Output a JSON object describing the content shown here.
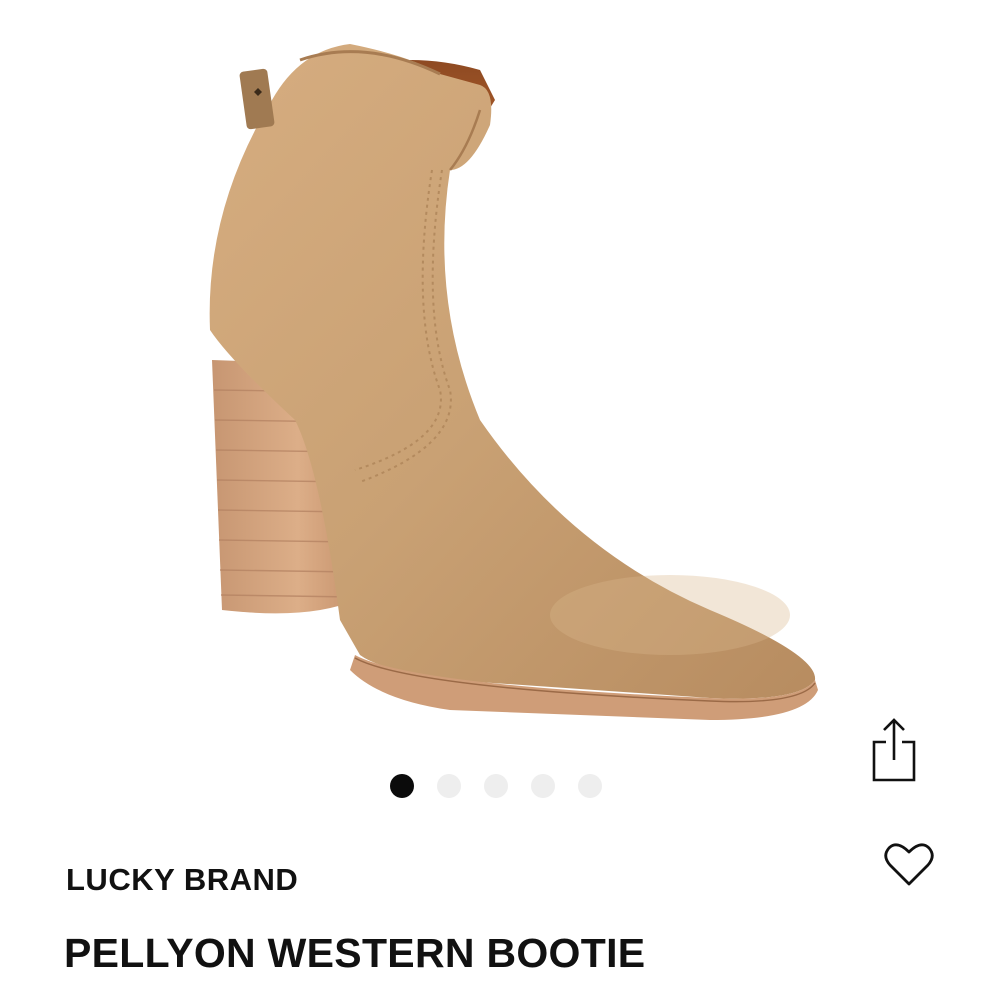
{
  "product": {
    "brand": "LUCKY BRAND",
    "name": "PELLYON WESTERN BOOTIE",
    "image_alt": "Tan suede western ankle bootie with stacked block heel"
  },
  "gallery": {
    "total_images": 5,
    "active_index": 0
  },
  "actions": {
    "share_icon": "share-icon",
    "favorite_icon": "heart-icon"
  },
  "colors": {
    "suede": "#c9a174",
    "heel_wood": "#d4a27c",
    "text": "#111111",
    "active_dot": "#0b0b0b",
    "inactive_dot": "#eeeeee"
  }
}
